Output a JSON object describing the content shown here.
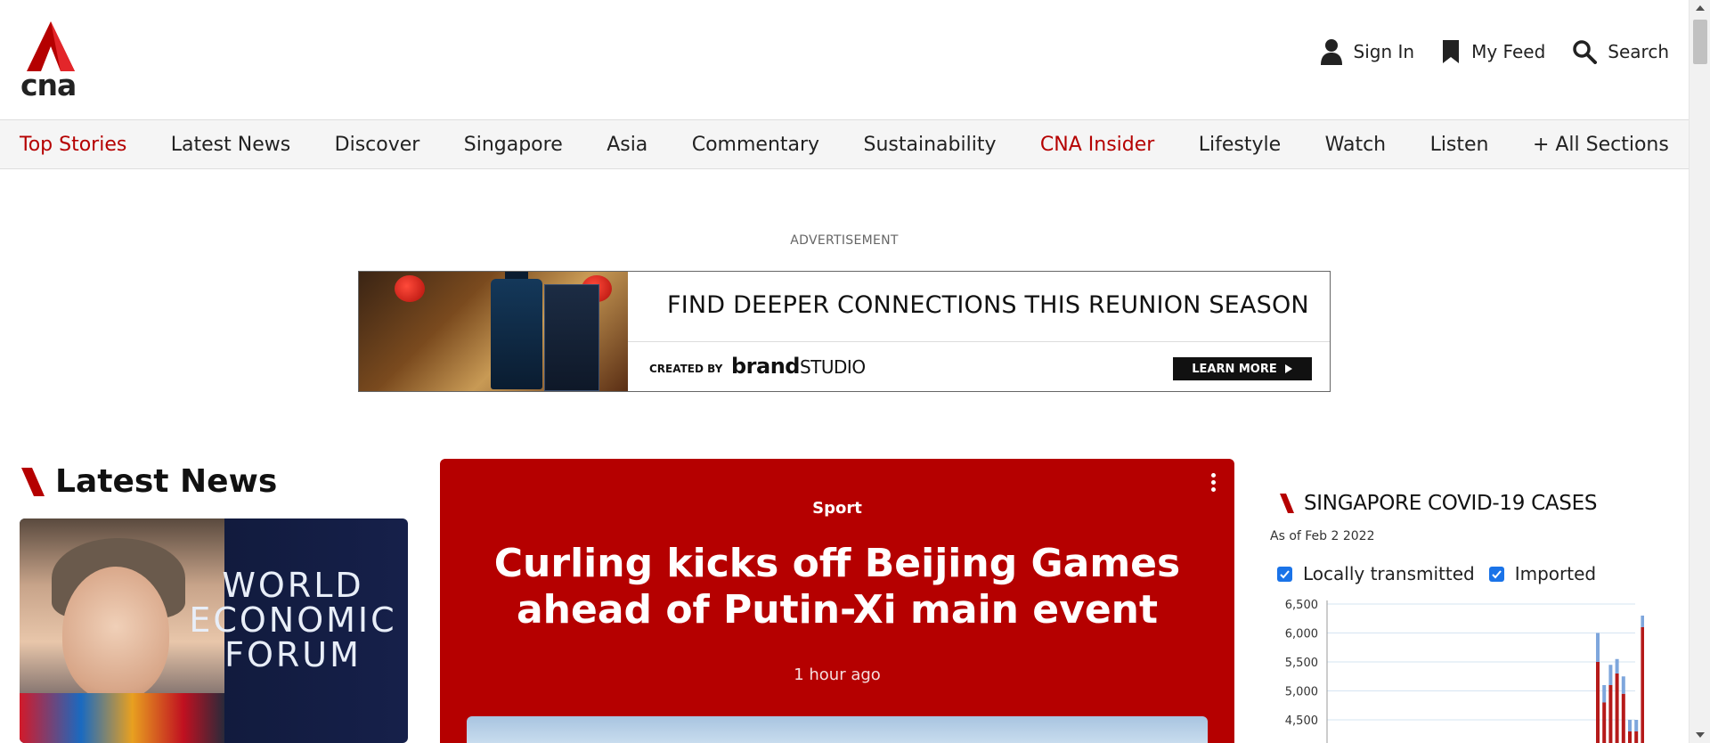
{
  "brand": {
    "logo_text": "cna",
    "accent_color": "#b50000"
  },
  "header_actions": {
    "sign_in": "Sign In",
    "my_feed": "My Feed",
    "search": "Search"
  },
  "nav": {
    "items": [
      {
        "label": "Top Stories",
        "accent": true
      },
      {
        "label": "Latest News",
        "accent": false
      },
      {
        "label": "Discover",
        "accent": false
      },
      {
        "label": "Singapore",
        "accent": false
      },
      {
        "label": "Asia",
        "accent": false
      },
      {
        "label": "Commentary",
        "accent": false
      },
      {
        "label": "Sustainability",
        "accent": false
      },
      {
        "label": "CNA Insider",
        "accent": true
      },
      {
        "label": "Lifestyle",
        "accent": false
      },
      {
        "label": "Watch",
        "accent": false
      },
      {
        "label": "Listen",
        "accent": false
      },
      {
        "label": "+ All Sections",
        "accent": false
      }
    ]
  },
  "ad": {
    "label": "ADVERTISEMENT",
    "headline": "FIND DEEPER CONNECTIONS THIS REUNION SEASON",
    "created_by": "CREATED BY",
    "brand_main": "brand",
    "brand_studio": "STUDIO",
    "cta": "LEARN MORE"
  },
  "latest_news": {
    "title": "Latest News",
    "card_image_text": [
      "WORLD",
      "ECONOMIC",
      "FORUM"
    ]
  },
  "feature": {
    "category": "Sport",
    "headline": "Curling kicks off Beijing Games ahead of Putin-Xi main event",
    "time": "1 hour ago"
  },
  "covid_widget": {
    "title": "SINGAPORE COVID-19 CASES",
    "as_of": "As of Feb 2 2022",
    "legend": {
      "local": "Locally transmitted",
      "imported": "Imported"
    }
  },
  "chart_data": {
    "type": "bar",
    "title": "SINGAPORE COVID-19 CASES",
    "stacked": true,
    "ylim": [
      4300,
      6500
    ],
    "yticks": [
      4500,
      5000,
      5500,
      6000,
      6500
    ],
    "ytick_labels": [
      "4,500",
      "5,000",
      "5,500",
      "6,000",
      "6,500"
    ],
    "grid": true,
    "series": [
      {
        "name": "Locally transmitted",
        "color": "#b51a1a",
        "values": [
          5500,
          4800,
          5100,
          5300,
          4950,
          4300,
          4300,
          6100
        ]
      },
      {
        "name": "Imported",
        "color": "#7ea6dc",
        "values": [
          500,
          300,
          350,
          250,
          300,
          200,
          200,
          200
        ]
      }
    ]
  }
}
